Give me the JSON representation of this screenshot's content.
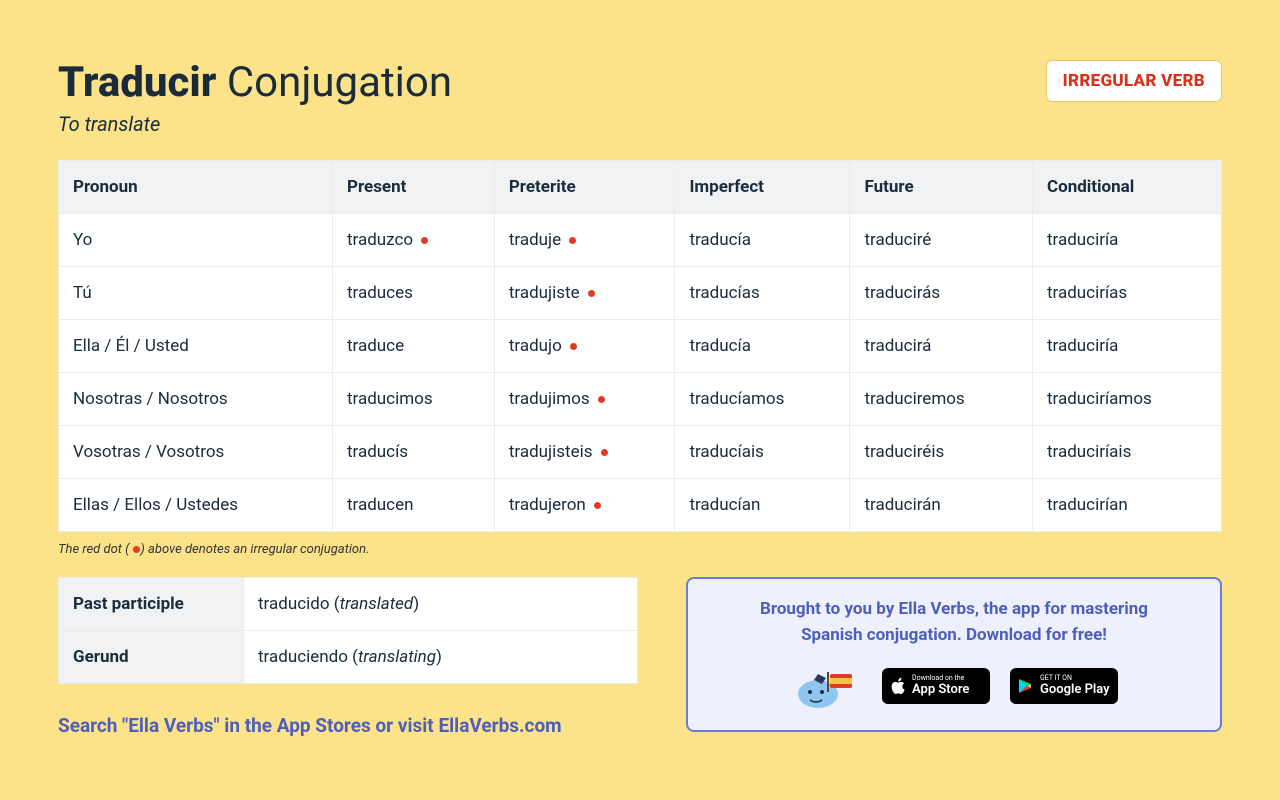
{
  "header": {
    "verb": "Traducir",
    "title_suffix": "Conjugation",
    "subtitle": "To translate",
    "badge": "IRREGULAR VERB"
  },
  "table": {
    "headers": [
      "Pronoun",
      "Present",
      "Preterite",
      "Imperfect",
      "Future",
      "Conditional"
    ],
    "rows": [
      {
        "pronoun": "Yo",
        "cells": [
          {
            "t": "traduzco",
            "irr": true
          },
          {
            "t": "traduje",
            "irr": true
          },
          {
            "t": "traducía",
            "irr": false
          },
          {
            "t": "traduciré",
            "irr": false
          },
          {
            "t": "traduciría",
            "irr": false
          }
        ]
      },
      {
        "pronoun": "Tú",
        "cells": [
          {
            "t": "traduces",
            "irr": false
          },
          {
            "t": "tradujiste",
            "irr": true
          },
          {
            "t": "traducías",
            "irr": false
          },
          {
            "t": "traducirás",
            "irr": false
          },
          {
            "t": "traducirías",
            "irr": false
          }
        ]
      },
      {
        "pronoun": "Ella / Él / Usted",
        "cells": [
          {
            "t": "traduce",
            "irr": false
          },
          {
            "t": "tradujo",
            "irr": true
          },
          {
            "t": "traducía",
            "irr": false
          },
          {
            "t": "traducirá",
            "irr": false
          },
          {
            "t": "traduciría",
            "irr": false
          }
        ]
      },
      {
        "pronoun": "Nosotras / Nosotros",
        "cells": [
          {
            "t": "traducimos",
            "irr": false
          },
          {
            "t": "tradujimos",
            "irr": true
          },
          {
            "t": "traducíamos",
            "irr": false
          },
          {
            "t": "traduciremos",
            "irr": false
          },
          {
            "t": "traduciríamos",
            "irr": false
          }
        ]
      },
      {
        "pronoun": "Vosotras / Vosotros",
        "cells": [
          {
            "t": "traducís",
            "irr": false
          },
          {
            "t": "tradujisteis",
            "irr": true
          },
          {
            "t": "traducíais",
            "irr": false
          },
          {
            "t": "traduciréis",
            "irr": false
          },
          {
            "t": "traduciríais",
            "irr": false
          }
        ]
      },
      {
        "pronoun": "Ellas / Ellos / Ustedes",
        "cells": [
          {
            "t": "traducen",
            "irr": false
          },
          {
            "t": "tradujeron",
            "irr": true
          },
          {
            "t": "traducían",
            "irr": false
          },
          {
            "t": "traducirán",
            "irr": false
          },
          {
            "t": "traducirían",
            "irr": false
          }
        ]
      }
    ]
  },
  "legend": {
    "prefix": "The red dot (",
    "suffix": ") above denotes an irregular conjugation."
  },
  "forms": {
    "past_participle": {
      "label": "Past participle",
      "value": "traducido",
      "gloss": "translated"
    },
    "gerund": {
      "label": "Gerund",
      "value": "traduciendo",
      "gloss": "translating"
    }
  },
  "searchline": {
    "part1": "Search \"Ella Verbs\" in the App Stores or ",
    "part2": "visit EllaVerbs.com"
  },
  "promo": {
    "line1": "Brought to you by Ella Verbs, the app for mastering",
    "line2": "Spanish conjugation. Download for free!",
    "appstore_small": "Download on the",
    "appstore_big": "App Store",
    "play_small": "GET IT ON",
    "play_big": "Google Play"
  }
}
